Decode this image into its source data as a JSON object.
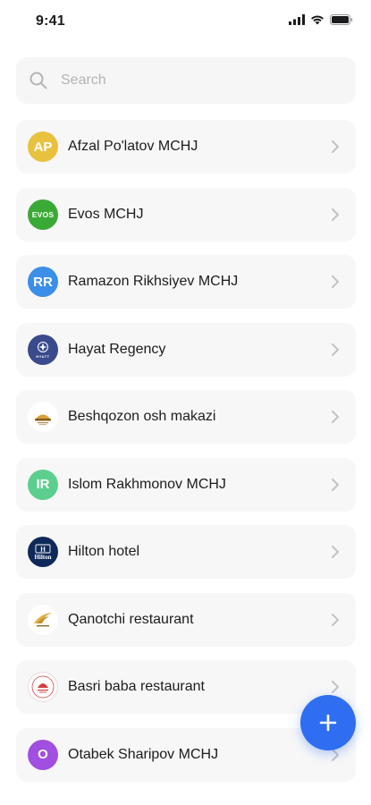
{
  "status": {
    "time": "9:41"
  },
  "search": {
    "placeholder": "Search",
    "value": ""
  },
  "items": [
    {
      "label": "Afzal Po'latov MCHJ",
      "avatar": "AP",
      "avatar_color": "#e8c13f",
      "avatar_type": "initials"
    },
    {
      "label": "Evos MCHJ",
      "avatar": "EVOS",
      "avatar_color": "#3aa935",
      "avatar_type": "logo-text"
    },
    {
      "label": "Ramazon Rikhsiyev MCHJ",
      "avatar": "RR",
      "avatar_color": "#3b8fe8",
      "avatar_type": "initials"
    },
    {
      "label": "Hayat Regency",
      "avatar": "HYATT",
      "avatar_color": "#3a4a8c",
      "avatar_type": "logo-text"
    },
    {
      "label": "Beshqozon osh makazi",
      "avatar": "beshqozon-logo",
      "avatar_color": "#ffffff",
      "avatar_type": "logo"
    },
    {
      "label": "Islom Rakhmonov MCHJ",
      "avatar": "IR",
      "avatar_color": "#5ccf8e",
      "avatar_type": "initials"
    },
    {
      "label": "Hilton hotel",
      "avatar": "Hilton",
      "avatar_color": "#0f2a5a",
      "avatar_type": "logo-text"
    },
    {
      "label": "Qanotchi restaurant",
      "avatar": "qanotchi-logo",
      "avatar_color": "#ffffff",
      "avatar_type": "logo"
    },
    {
      "label": "Basri baba restaurant",
      "avatar": "basri-baba-logo",
      "avatar_color": "#ffffff",
      "avatar_type": "logo"
    },
    {
      "label": "Otabek Sharipov MCHJ",
      "avatar": "O",
      "avatar_color": "#a04fe0",
      "avatar_type": "initials"
    }
  ],
  "fab": {
    "icon": "plus-icon",
    "color": "#2f6ef0"
  }
}
